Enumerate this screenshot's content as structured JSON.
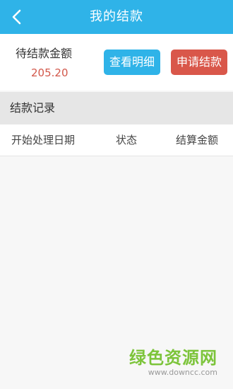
{
  "header": {
    "title": "我的结款",
    "back_icon": "chevron-left-icon",
    "background": "#2fb3e8"
  },
  "summary": {
    "pending_label": "待结款金额",
    "pending_amount": "205.20",
    "amount_color": "#d2574a",
    "detail_button": "查看明细",
    "detail_color": "#2fb3e8",
    "apply_button": "申请结款",
    "apply_color": "#d9574a"
  },
  "records": {
    "section_title": "结款记录",
    "columns": [
      "开始处理日期",
      "状态",
      "结算金额"
    ],
    "rows": []
  },
  "watermark": {
    "cn": "绿色资源网",
    "url": "www.downcc.com",
    "color": "#7cc43a"
  }
}
